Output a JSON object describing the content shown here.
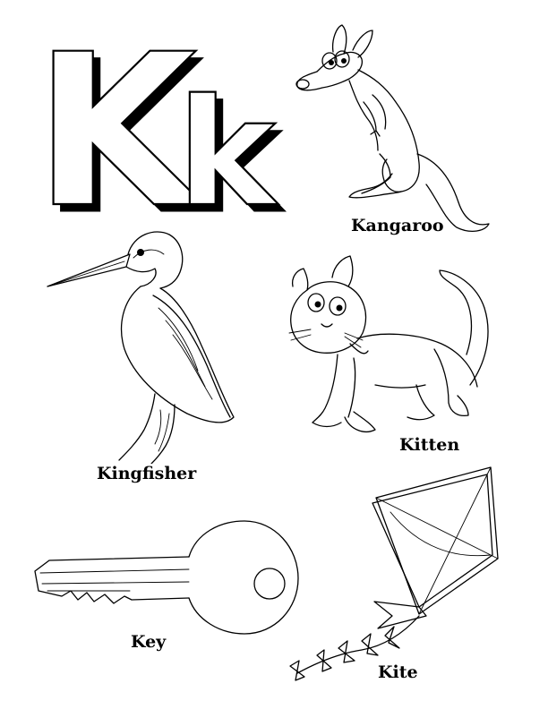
{
  "letters": {
    "upper": "K",
    "lower": "k"
  },
  "items": [
    {
      "label": "Kangaroo",
      "icon": "kangaroo-icon"
    },
    {
      "label": "Kingfisher",
      "icon": "kingfisher-icon"
    },
    {
      "label": "Kitten",
      "icon": "kitten-icon"
    },
    {
      "label": "Key",
      "icon": "key-icon"
    },
    {
      "label": "Kite",
      "icon": "kite-icon"
    }
  ],
  "colors": {
    "ink": "#000000",
    "paper": "#ffffff"
  }
}
